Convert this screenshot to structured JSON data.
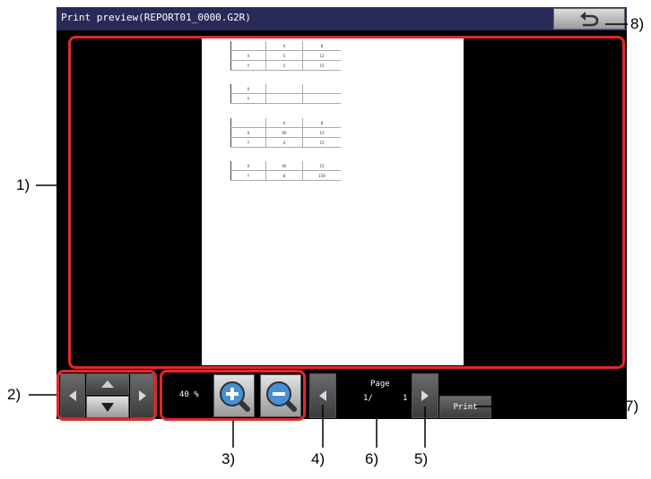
{
  "window": {
    "title": "Print preview(REPORT01_0000.G2R)"
  },
  "preview": {
    "tables": [
      {
        "rows": [
          [
            "",
            "A",
            "B"
          ],
          [
            "X",
            "5",
            "12"
          ],
          [
            "Y",
            "5",
            "15"
          ]
        ]
      },
      {
        "rows": [
          [
            "X",
            "",
            ""
          ],
          [
            "Y",
            "",
            ""
          ]
        ]
      },
      {
        "rows": [
          [
            "",
            "A",
            "B"
          ],
          [
            "X",
            "90",
            "15"
          ],
          [
            "Y",
            "4",
            "15"
          ]
        ]
      },
      {
        "rows": [
          [
            "X",
            "90",
            "15"
          ],
          [
            "Y",
            "8",
            "159"
          ]
        ]
      }
    ]
  },
  "controls": {
    "zoom_value": "40 %",
    "page_label": "Page",
    "page_current": "1/",
    "page_total": "1",
    "print_label": "Print"
  },
  "callouts": {
    "c1": "1)",
    "c2": "2)",
    "c3": "3)",
    "c4": "4)",
    "c5": "5)",
    "c6": "6)",
    "c7": "7)",
    "c8": "8)"
  },
  "colors": {
    "titlebar": "#2a2a58",
    "callout_red": "#e0282f",
    "background": "#000000"
  },
  "icons": {
    "back": "return-arrow-icon",
    "scroll": [
      "arrow-left-icon",
      "arrow-up-icon",
      "arrow-down-icon",
      "arrow-right-icon"
    ],
    "zoom": [
      "zoom-in-icon",
      "zoom-out-icon"
    ],
    "page": [
      "prev-page-icon",
      "next-page-icon"
    ]
  }
}
